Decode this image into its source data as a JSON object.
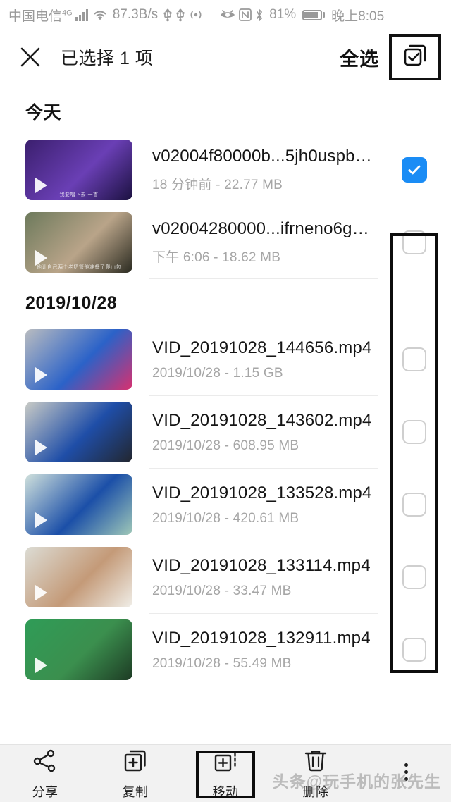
{
  "colors": {
    "accent": "#1a8cf5",
    "annotation": "#0d0d0d",
    "status_text": "#9a9a9a",
    "secondary_text": "#a6a6a6",
    "bottom_bar_bg": "#f2f2f2"
  },
  "statusbar": {
    "carrier": "中国电信",
    "network_type": "4G",
    "signal_icon": "signal-bars-icon",
    "wifi_icon": "wifi-icon",
    "speed": "87.3B/s",
    "usb_icon_1": "usb-icon",
    "usb_icon_2": "usb-icon",
    "hotspot_icon": "hotspot-icon",
    "eye_icon": "eye-comfort-icon",
    "nfc_icon": "nfc-icon",
    "bluetooth_icon": "bluetooth-icon",
    "battery_percent": "81%",
    "battery_icon": "battery-icon",
    "time": "晚上8:05"
  },
  "header": {
    "close_icon": "close-icon",
    "title": "已选择 1 项",
    "select_all_label": "全选",
    "select_all_icon": "select-all-checkbox-icon"
  },
  "sections": [
    {
      "title": "今天",
      "items": [
        {
          "name": "v02004f80000b...5jh0uspb0.mp4",
          "subtitle": "18 分钟前 - 22.77 MB",
          "selected": true,
          "thumb_caption": "我要唱下去 一首",
          "thumb_colors": [
            "#3b1f6e",
            "#6a3fb5",
            "#1b1140"
          ]
        },
        {
          "name": "v02004280000...ifrneno6gg.mp4",
          "subtitle": "下午 6:06 - 18.62 MB",
          "selected": false,
          "thumb_caption": "他让自己两个老奶管他准备了爬山包",
          "thumb_colors": [
            "#6d7a5c",
            "#b9a489",
            "#2a2a20"
          ]
        }
      ]
    },
    {
      "title": "2019/10/28",
      "items": [
        {
          "name": "VID_20191028_144656.mp4",
          "subtitle": "2019/10/28 - 1.15 GB",
          "selected": false,
          "thumb_caption": "",
          "thumb_colors": [
            "#b9bcc0",
            "#2b62c8",
            "#d8306f"
          ]
        },
        {
          "name": "VID_20191028_143602.mp4",
          "subtitle": "2019/10/28 - 608.95 MB",
          "selected": false,
          "thumb_caption": "",
          "thumb_colors": [
            "#c9cbc6",
            "#1f4ea8",
            "#22262e"
          ]
        },
        {
          "name": "VID_20191028_133528.mp4",
          "subtitle": "2019/10/28 - 420.61 MB",
          "selected": false,
          "thumb_caption": "",
          "thumb_colors": [
            "#cfe0dc",
            "#1b4fa8",
            "#9fc8b8"
          ]
        },
        {
          "name": "VID_20191028_133114.mp4",
          "subtitle": "2019/10/28 - 33.47 MB",
          "selected": false,
          "thumb_caption": "",
          "thumb_colors": [
            "#dcdcd4",
            "#c49a78",
            "#f0eee8"
          ]
        },
        {
          "name": "VID_20191028_132911.mp4",
          "subtitle": "2019/10/28 - 55.49 MB",
          "selected": false,
          "thumb_caption": "",
          "thumb_colors": [
            "#2f9c57",
            "#3b8f4e",
            "#1d3b24"
          ]
        }
      ]
    }
  ],
  "bottombar": {
    "items": [
      {
        "label": "分享",
        "icon": "share-icon",
        "highlighted": false
      },
      {
        "label": "复制",
        "icon": "copy-icon",
        "highlighted": false
      },
      {
        "label": "移动",
        "icon": "move-icon",
        "highlighted": true
      },
      {
        "label": "删除",
        "icon": "trash-icon",
        "highlighted": false
      },
      {
        "label": "",
        "icon": "more-vertical-icon",
        "highlighted": false
      }
    ]
  },
  "watermark": "头条@玩手机的张先生"
}
